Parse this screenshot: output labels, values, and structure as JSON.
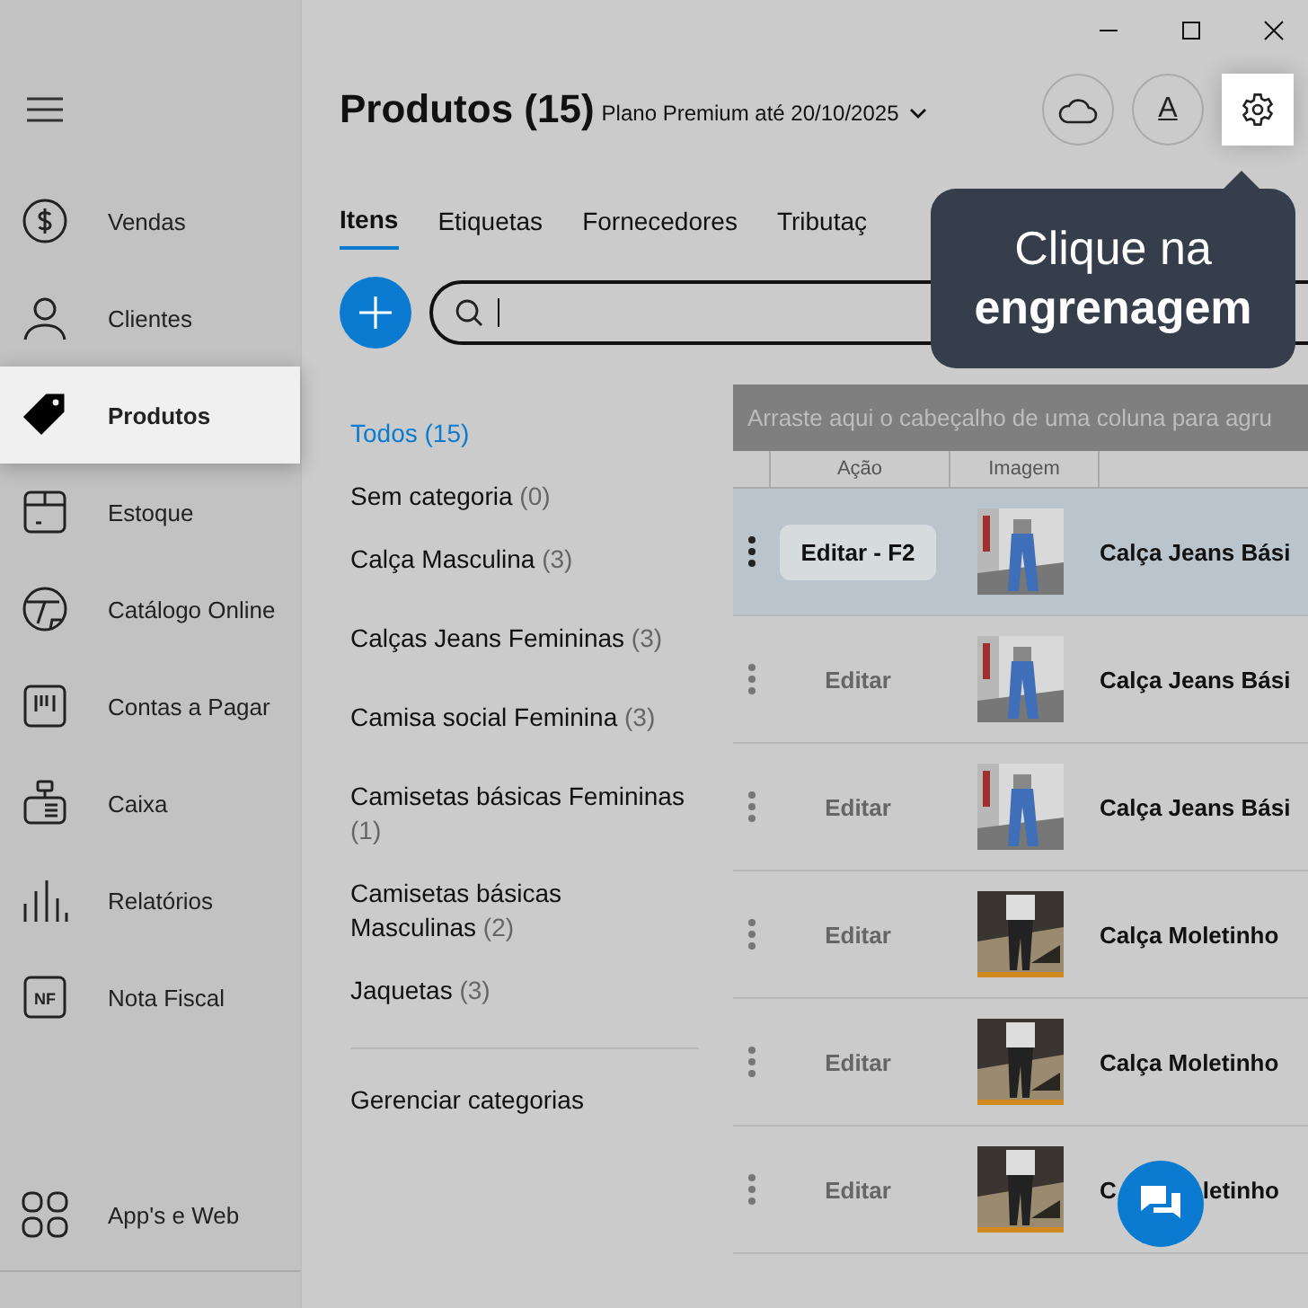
{
  "sidebar": {
    "items": [
      {
        "label": "Vendas",
        "selected": false
      },
      {
        "label": "Clientes",
        "selected": false
      },
      {
        "label": "Produtos",
        "selected": true
      },
      {
        "label": "Estoque",
        "selected": false
      },
      {
        "label": "Catálogo Online",
        "selected": false
      },
      {
        "label": "Contas a Pagar",
        "selected": false
      },
      {
        "label": "Caixa",
        "selected": false
      },
      {
        "label": "Relatórios",
        "selected": false
      },
      {
        "label": "Nota Fiscal",
        "selected": false,
        "icon_label": "NF"
      }
    ],
    "bottom_item": {
      "label": "App's e Web"
    }
  },
  "header": {
    "title": "Produtos (15)",
    "plan": "Plano Premium até 20/10/2025",
    "font_button": "A"
  },
  "tabs": [
    {
      "label": "Itens",
      "selected": true
    },
    {
      "label": "Etiquetas",
      "selected": false
    },
    {
      "label": "Fornecedores",
      "selected": false
    },
    {
      "label": "Tributaç",
      "selected": false
    }
  ],
  "tooltip": {
    "text": "Clique na **engrenagem**"
  },
  "categories": [
    {
      "name": "Todos",
      "count": "(15)",
      "selected": true
    },
    {
      "name": "Sem categoria",
      "count": "(0)",
      "selected": false
    },
    {
      "name": "Calça Masculina",
      "count": "(3)",
      "selected": false
    },
    {
      "name": "Calças Jeans Femininas",
      "count": "(3)",
      "selected": false
    },
    {
      "name": "Camisa social Feminina",
      "count": "(3)",
      "selected": false
    },
    {
      "name": "Camisetas básicas Femininas",
      "count": "(1)",
      "selected": false
    },
    {
      "name": "Camisetas básicas Masculinas",
      "count": "(2)",
      "selected": false
    },
    {
      "name": "Jaquetas",
      "count": "(3)",
      "selected": false
    }
  ],
  "manage_categories": "Gerenciar categorias",
  "table": {
    "group_hint": "Arraste aqui o cabeçalho de uma coluna para agru",
    "columns": [
      "Ação",
      "Imagem"
    ],
    "rows": [
      {
        "action": "Editar - F2",
        "name": "Calça Jeans Bási",
        "selected": true
      },
      {
        "action": "Editar",
        "name": "Calça Jeans Bási",
        "selected": false
      },
      {
        "action": "Editar",
        "name": "Calça Jeans Bási",
        "selected": false
      },
      {
        "action": "Editar",
        "name": "Calça Moletinho",
        "selected": false
      },
      {
        "action": "Editar",
        "name": "Calça Moletinho",
        "selected": false
      },
      {
        "action": "Editar",
        "name": "C",
        "name_tail": "letinho",
        "selected": false
      }
    ]
  }
}
